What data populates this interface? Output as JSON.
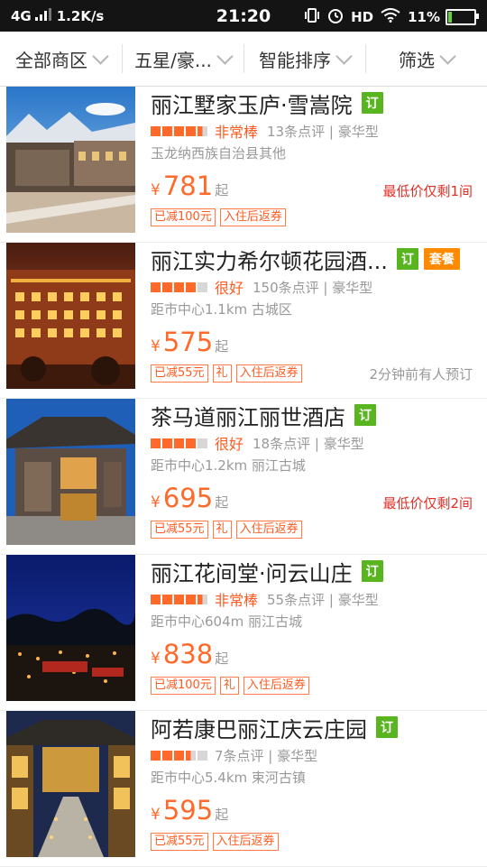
{
  "status": {
    "network": "4G",
    "speed": "1.2K/s",
    "time": "21:20",
    "hd": "HD",
    "battery": "11%"
  },
  "filters": [
    {
      "label": "全部商区"
    },
    {
      "label": "五星/豪..."
    },
    {
      "label": "智能排序"
    },
    {
      "label": "筛选"
    }
  ],
  "colors": {
    "accent": "#ff6a2b",
    "book_tag": "#58b51f",
    "package_tag": "#ff8a00",
    "alert": "#e02e24"
  },
  "hotels": [
    {
      "name": "丽江墅家玉庐·雪嵩院",
      "book_tag": "订",
      "stars": 4.5,
      "rating_word": "非常棒",
      "reviews": "13条点评 | 豪华型",
      "location": "玉龙纳西族自治县其他",
      "currency": "¥",
      "price": "781",
      "price_suffix": "起",
      "price_note": "最低价仅剩1间",
      "badges": [
        "已减100元",
        "入住后返券"
      ]
    },
    {
      "name": "丽江实力希尔顿花园酒...",
      "book_tag": "订",
      "package_tag": "套餐",
      "stars": 4,
      "rating_word": "很好",
      "reviews": "150条点评 | 豪华型",
      "location": "距市中心1.1km 古城区",
      "currency": "¥",
      "price": "575",
      "price_suffix": "起",
      "badges": [
        "已减55元",
        "礼",
        "入住后返券"
      ],
      "recent_note": "2分钟前有人预订"
    },
    {
      "name": "茶马道丽江丽世酒店",
      "book_tag": "订",
      "stars": 4,
      "rating_word": "很好",
      "reviews": "18条点评 | 豪华型",
      "location": "距市中心1.2km 丽江古城",
      "currency": "¥",
      "price": "695",
      "price_suffix": "起",
      "price_note": "最低价仅剩2间",
      "badges": [
        "已减55元",
        "礼",
        "入住后返券"
      ]
    },
    {
      "name": "丽江花间堂·问云山庄",
      "book_tag": "订",
      "stars": 4.5,
      "rating_word": "非常棒",
      "reviews": "55条点评 | 豪华型",
      "location": "距市中心604m 丽江古城",
      "currency": "¥",
      "price": "838",
      "price_suffix": "起",
      "badges": [
        "已减100元",
        "礼",
        "入住后返券"
      ]
    },
    {
      "name": "阿若康巴丽江庆云庄园",
      "book_tag": "订",
      "stars": 3.5,
      "reviews": "7条点评 | 豪华型",
      "location": "距市中心5.4km 束河古镇",
      "currency": "¥",
      "price": "595",
      "price_suffix": "起",
      "badges": [
        "已减55元",
        "入住后返券"
      ]
    }
  ]
}
